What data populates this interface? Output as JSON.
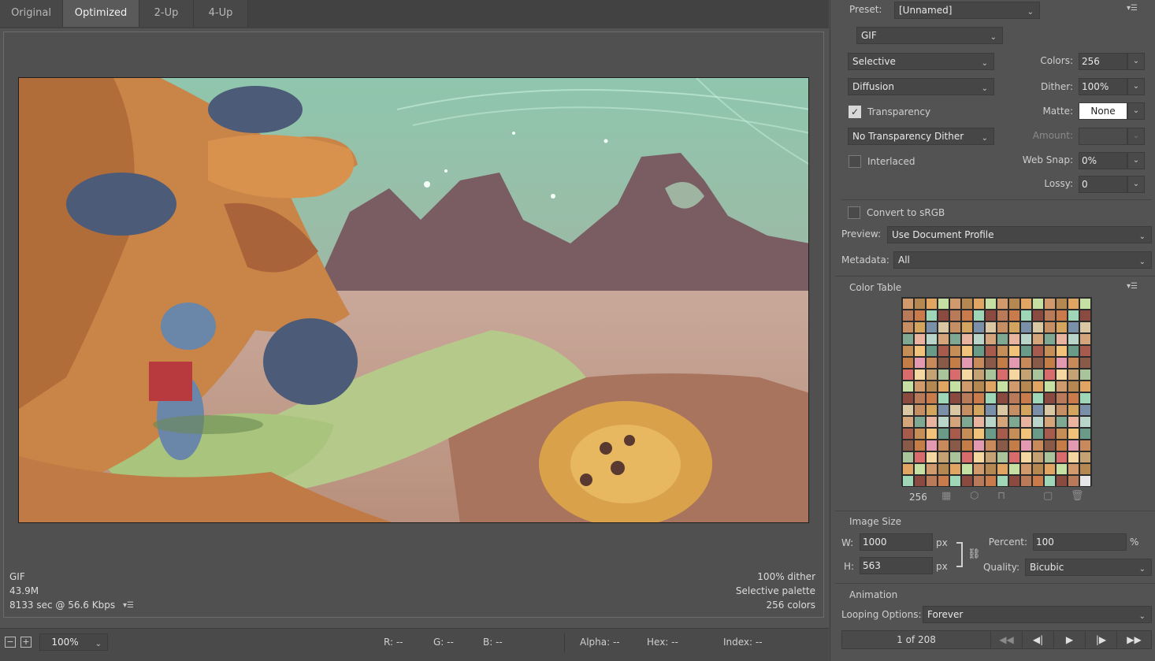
{
  "tabs": [
    {
      "label": "Original",
      "active": false
    },
    {
      "label": "Optimized",
      "active": true
    },
    {
      "label": "2-Up",
      "active": false
    },
    {
      "label": "4-Up",
      "active": false
    }
  ],
  "status": {
    "format": "GIF",
    "size": "43.9M",
    "time": "8133 sec @ 56.6 Kbps",
    "dither": "100% dither",
    "palette": "Selective palette",
    "colors": "256 colors"
  },
  "bottom": {
    "zoom": "100%",
    "r": "R: --",
    "g": "G: --",
    "b": "B: --",
    "alpha": "Alpha: --",
    "hex": "Hex: --",
    "index": "Index: --"
  },
  "panel": {
    "preset_label": "Preset:",
    "preset_value": "[Unnamed]",
    "format_value": "GIF",
    "reduction_value": "Selective",
    "dither_algo_value": "Diffusion",
    "transparency_label": "Transparency",
    "transparency_dither_value": "No Transparency Dither",
    "interlaced_label": "Interlaced",
    "colors_label": "Colors:",
    "colors_value": "256",
    "dither_label": "Dither:",
    "dither_value": "100%",
    "matte_label": "Matte:",
    "matte_value": "None",
    "amount_label": "Amount:",
    "websnap_label": "Web Snap:",
    "websnap_value": "0%",
    "lossy_label": "Lossy:",
    "lossy_value": "0",
    "srgb_label": "Convert to sRGB",
    "preview_label": "Preview:",
    "preview_value": "Use Document Profile",
    "metadata_label": "Metadata:",
    "metadata_value": "All",
    "color_table_label": "Color Table",
    "color_count": "256",
    "image_size_label": "Image Size",
    "w_label": "W:",
    "w_value": "1000",
    "h_label": "H:",
    "h_value": "563",
    "px": "px",
    "percent_label": "Percent:",
    "percent_value": "100",
    "percent_unit": "%",
    "quality_label": "Quality:",
    "quality_value": "Bicubic",
    "animation_label": "Animation",
    "looping_label": "Looping Options:",
    "looping_value": "Forever",
    "frame_counter": "1 of 208"
  },
  "colors": {
    "panel_bg": "#535353",
    "tab_active": "#5a5a5a",
    "swatches": [
      "#d19a6c",
      "#c98a5b",
      "#d4a57a",
      "#b97a5a",
      "#c4a273",
      "#a65b4d",
      "#c68f63",
      "#b58852",
      "#8a5a48",
      "#7ea891",
      "#c97b4c",
      "#a9c49b",
      "#c68e57",
      "#d2a45e",
      "#e0a562",
      "#c57d47"
    ]
  }
}
